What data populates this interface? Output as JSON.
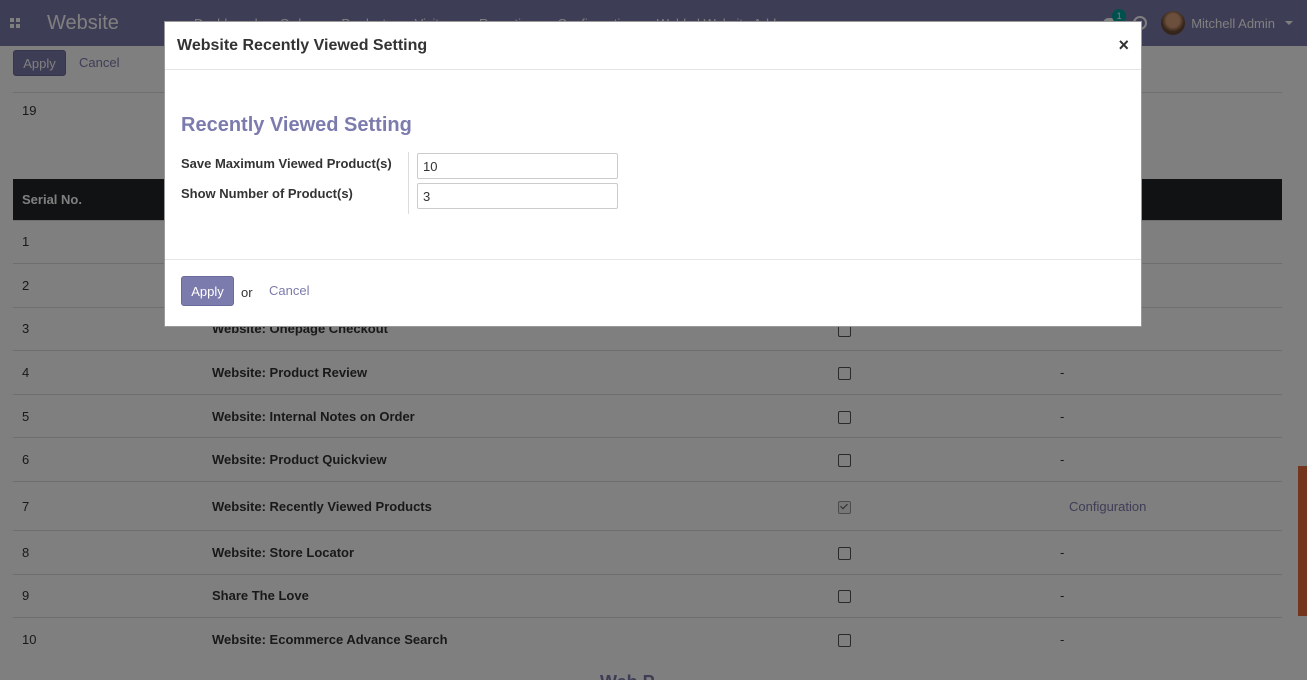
{
  "navbar": {
    "brand": "Website",
    "menu": [
      "Dashboard",
      "Orders",
      "Products",
      "Visitors",
      "Reporting",
      "Configuration",
      "Webkul Website Addons"
    ],
    "chat_badge": "1",
    "user_name": "Mitchell Admin"
  },
  "control": {
    "apply_label": "Apply",
    "cancel_label": "Cancel"
  },
  "content": {
    "top_row_number": "19",
    "table": {
      "headers": [
        "Serial No.",
        "",
        "",
        ""
      ],
      "rows": [
        {
          "serial": "1",
          "name": "",
          "checked": false,
          "config": ""
        },
        {
          "serial": "2",
          "name": "",
          "checked": false,
          "config": ""
        },
        {
          "serial": "3",
          "name": "Website: Onepage Checkout",
          "checked": false,
          "config": ""
        },
        {
          "serial": "4",
          "name": "Website: Product Review",
          "checked": false,
          "config": "-"
        },
        {
          "serial": "5",
          "name": "Website: Internal Notes on Order",
          "checked": false,
          "config": "-"
        },
        {
          "serial": "6",
          "name": "Website: Product Quickview",
          "checked": false,
          "config": "-"
        },
        {
          "serial": "7",
          "name": "Website: Recently Viewed Products",
          "checked": true,
          "config": "Configuration"
        },
        {
          "serial": "8",
          "name": "Website: Store Locator",
          "checked": false,
          "config": "-"
        },
        {
          "serial": "9",
          "name": "Share The Love",
          "checked": false,
          "config": "-"
        },
        {
          "serial": "10",
          "name": "Website: Ecommerce Advance Search",
          "checked": false,
          "config": "-"
        }
      ]
    },
    "footer_heading": "Web P"
  },
  "modal": {
    "title": "Website Recently Viewed Setting",
    "close_label": "×",
    "section_title": "Recently Viewed Setting",
    "fields": {
      "max_viewed_label": "Save Maximum Viewed Product(s)",
      "max_viewed_value": "10",
      "show_number_label": "Show Number of Product(s)",
      "show_number_value": "3"
    },
    "footer": {
      "apply_label": "Apply",
      "or_text": "or",
      "cancel_label": "Cancel"
    }
  },
  "colors": {
    "brand": "#7c7bad",
    "table_header": "#212529",
    "scroll_accent": "#e96b3e"
  }
}
